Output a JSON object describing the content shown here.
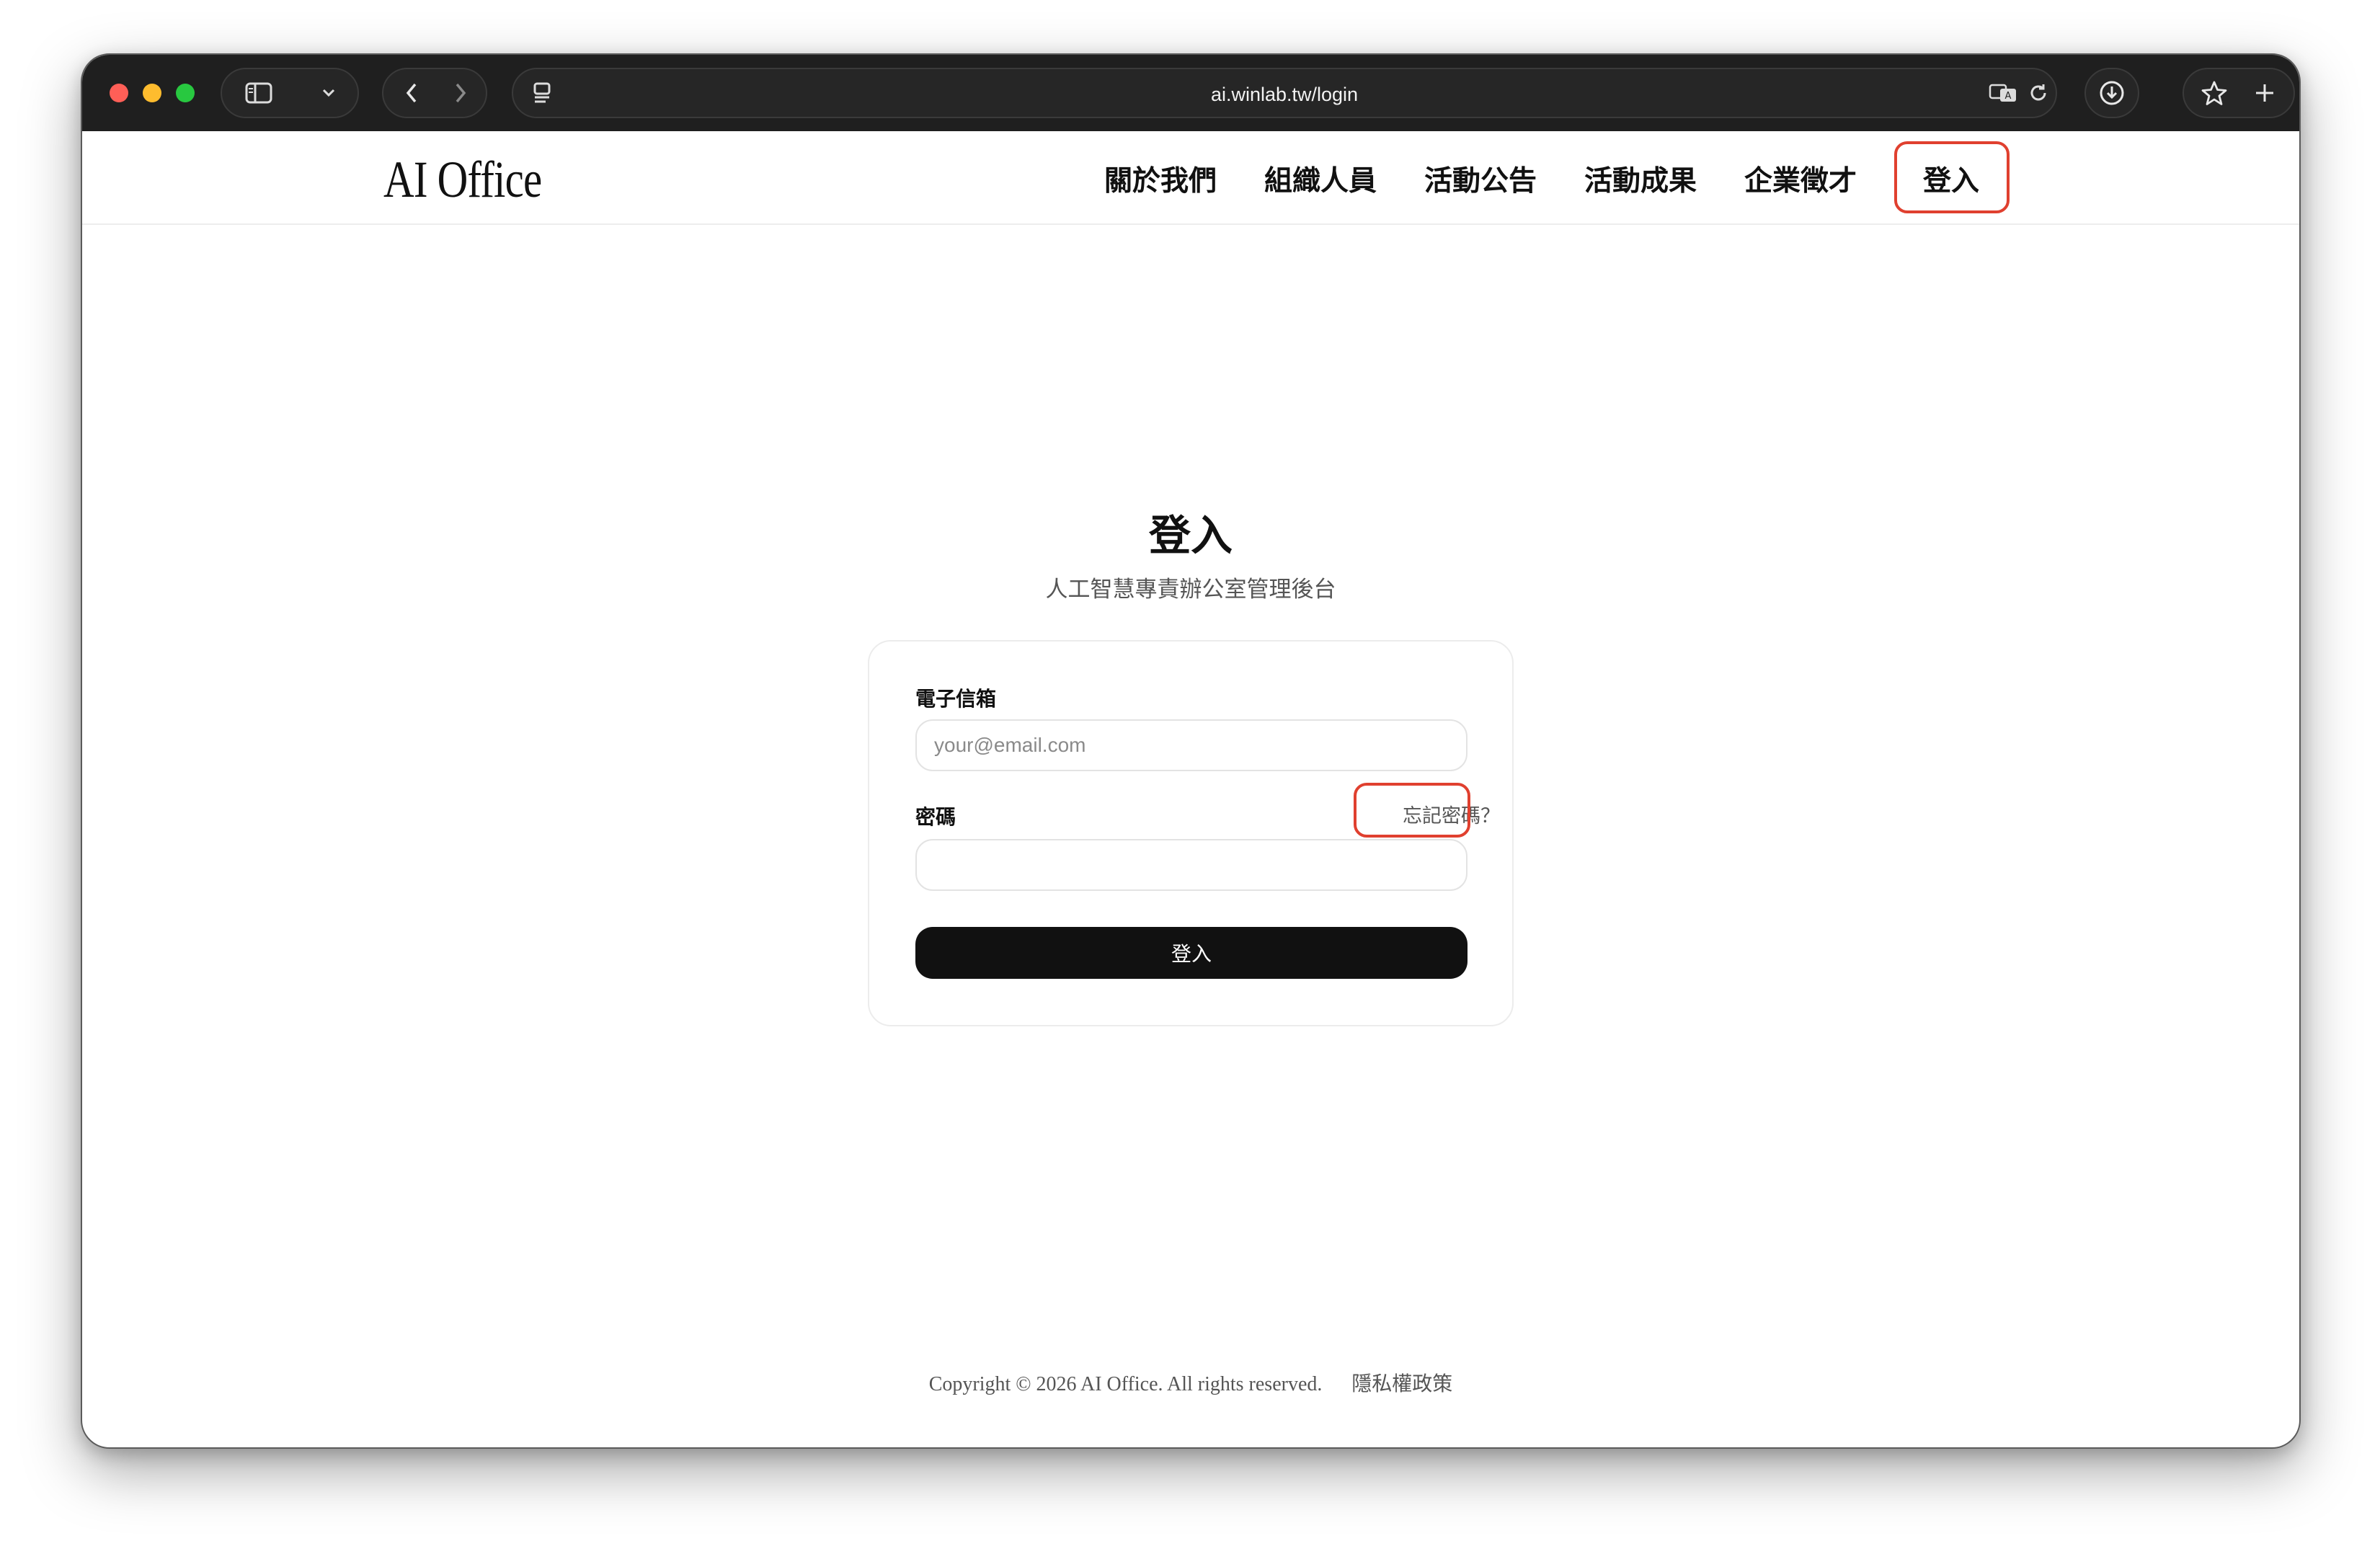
{
  "browser": {
    "url": "ai.winlab.tw/login",
    "icons": {
      "sidebar": "sidebar-icon",
      "dropdown": "chevron-down-icon",
      "back": "chevron-left-icon",
      "forward": "chevron-right-icon",
      "tab_overview": "page-icon",
      "translate": "translate-icon",
      "reload": "reload-icon",
      "download": "download-icon",
      "bookmark": "star-icon",
      "new_tab": "plus-icon"
    }
  },
  "site": {
    "logo": "AI Office",
    "nav": [
      {
        "label": "關於我們"
      },
      {
        "label": "組織人員"
      },
      {
        "label": "活動公告"
      },
      {
        "label": "活動成果"
      },
      {
        "label": "企業徵才"
      },
      {
        "label": "登入"
      }
    ]
  },
  "login": {
    "title": "登入",
    "subtitle": "人工智慧專責辦公室管理後台",
    "email_label": "電子信箱",
    "email_placeholder": "your@email.com",
    "email_value": "",
    "password_label": "密碼",
    "password_value": "",
    "forgot_link": "忘記密碼？",
    "submit_label": "登入"
  },
  "footer": {
    "copyright": "Copyright © 2026 AI Office. All rights reserved.",
    "privacy": "隱私權政策"
  },
  "colors": {
    "highlight": "#e0402f",
    "button": "#111111",
    "toolbar": "#1f1f1f"
  }
}
